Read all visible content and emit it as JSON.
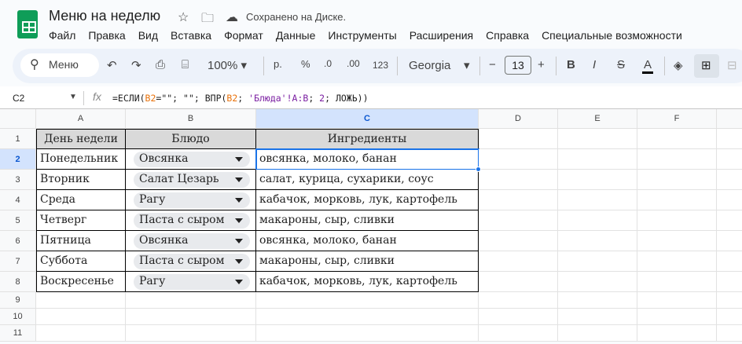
{
  "doc": {
    "title": "Меню на неделю",
    "saved": "Сохранено на Диске."
  },
  "menu": [
    "Файл",
    "Правка",
    "Вид",
    "Вставка",
    "Формат",
    "Данные",
    "Инструменты",
    "Расширения",
    "Справка",
    "Специальные возможности"
  ],
  "toolbar": {
    "search": "Меню",
    "zoom": "100%",
    "currency": "р.",
    "percent": "%",
    "dec_less": ".0",
    "dec_more": ".00",
    "number_format": "123",
    "font": "Georgia",
    "font_size": "13"
  },
  "formula_bar": {
    "cell_ref": "C2",
    "parts": [
      "=ЕСЛИ(",
      "B2",
      "=\"\"; \"\"; ВПР(",
      "B2",
      "; ",
      "'Блюда'!A:B",
      "; ",
      "2",
      "; ЛОЖЬ))"
    ]
  },
  "columns": [
    "A",
    "B",
    "C",
    "D",
    "E",
    "F"
  ],
  "rows": [
    "1",
    "2",
    "3",
    "4",
    "5",
    "6",
    "7",
    "8",
    "9",
    "10",
    "11"
  ],
  "table": {
    "headers": [
      "День недели",
      "Блюдо",
      "Ингредиенты"
    ],
    "data": [
      [
        "Понедельник",
        "Овсянка",
        "овсянка, молоко, банан"
      ],
      [
        "Вторник",
        "Салат Цезарь",
        "салат, курица, сухарики, соус"
      ],
      [
        "Среда",
        "Рагу",
        "кабачок, морковь, лук, картофель"
      ],
      [
        "Четверг",
        "Паста с сыром",
        "макароны, сыр, сливки"
      ],
      [
        "Пятница",
        "Овсянка",
        "овсянка, молоко, банан"
      ],
      [
        "Суббота",
        "Паста с сыром",
        "макароны, сыр, сливки"
      ],
      [
        "Воскресенье",
        "Рагу",
        "кабачок, морковь, лук, картофель"
      ]
    ]
  },
  "colors": {
    "accent": "#1a73e8",
    "header_fill": "#d9d9d9",
    "selected_col": "#d3e3fd"
  }
}
